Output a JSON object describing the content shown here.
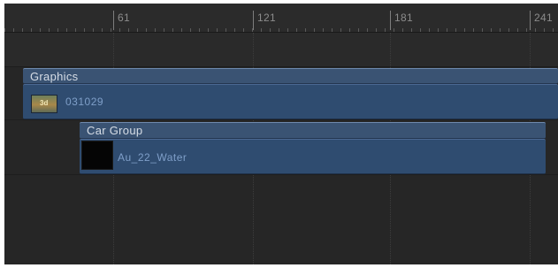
{
  "ruler": {
    "labels": [
      "61",
      "121",
      "181",
      "241"
    ]
  },
  "tracks": {
    "graphics": {
      "group_label": "Graphics",
      "layer_label": "031029",
      "thumbnail_text": "3d"
    },
    "car_group": {
      "group_label": "Car Group",
      "layer_label": "Au_22_Water"
    }
  },
  "colors": {
    "background": "#262626",
    "group_header": "#3a5373",
    "layer_bar": "#2f4c70",
    "layer_text": "#7f9fc9"
  }
}
